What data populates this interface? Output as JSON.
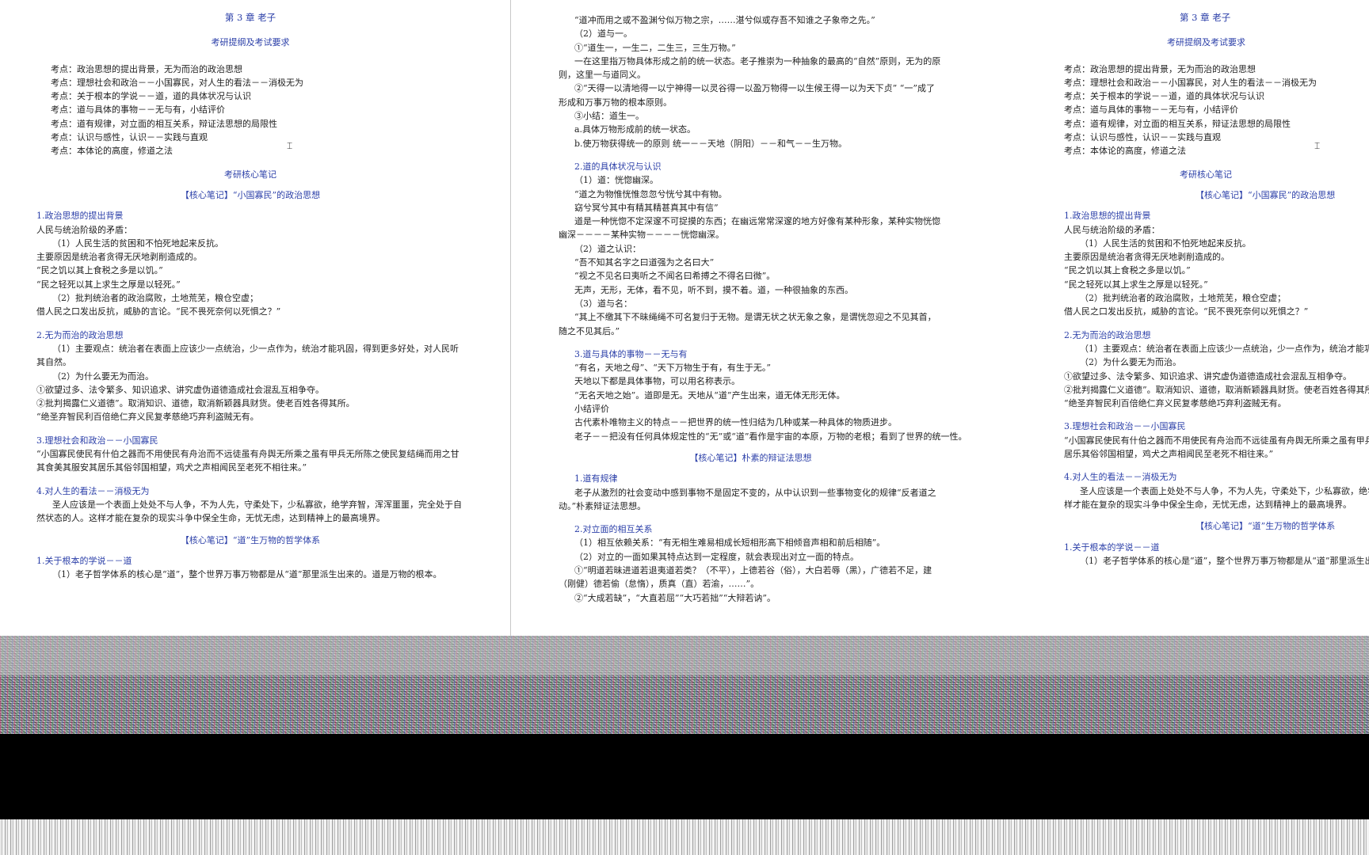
{
  "chapter_title": "第 3 章   老子",
  "outline_heading": "考研提纲及考试要求",
  "exam_points": [
    "考点：政治思想的提出背景，无为而治的政治思想",
    "考点：理想社会和政治－－小国寡民，对人生的看法－－消极无为",
    "考点：关于根本的学说－－道，道的具体状况与认识",
    "考点：道与具体的事物－－无与有，小结评价",
    "考点：道有规律，对立面的相互关系，辩证法思想的局限性",
    "考点：认识与感性，认识－－实践与直观",
    "考点：本体论的高度，修道之法"
  ],
  "notes_heading": "考研核心笔记",
  "left_page": {
    "core1": "【核心笔记】“小国寡民”的政治思想",
    "s1_heading": "1.政治思想的提出背景",
    "s1_lines": [
      "人民与统治阶级的矛盾：",
      "（1）人民生活的贫困和不怕死地起来反抗。",
      "主要原因是统治者贪得无厌地剥削造成的。",
      "“民之饥以其上食税之多是以饥。”",
      "“民之轻死以其上求生之厚是以轻死。”",
      "（2）批判统治者的政治腐败，土地荒芜，粮仓空虚；",
      "借人民之口发出反抗，威胁的言论。“民不畏死奈何以死惧之？”"
    ],
    "s2_heading": "2.无为而治的政治思想",
    "s2_lines": [
      "（1）主要观点：统治者在表面上应该少一点统治，少一点作为，统治才能巩固，得到更多好处，对人民听其自然。",
      "（2）为什么要无为而治。",
      "①欲望过多、法令繁多、知识追求、讲究虚伪道德造成社会混乱互相争夺。",
      "②批判揭露仁义道德”。取消知识、道德，取消新颖器具财货。使老百姓各得其所。",
      "“绝圣弃智民利百倍绝仁弃义民复孝慈绝巧弃利盗贼无有。"
    ],
    "s3_heading": "3.理想社会和政治－－小国寡民",
    "s3_lines": [
      "“小国寡民使民有什伯之器而不用使民有舟治而不远徒虽有舟舆无所乘之虽有甲兵无所陈之使民复结绳而用之甘其食美其服安其居乐其俗邻国相望，鸡犬之声相闻民至老死不相往来。”"
    ],
    "s4_heading": "4.对人生的看法－－消极无为",
    "s4_lines": [
      "圣人应该是一个表面上处处不与人争，不为人先，守柔处下，少私寡欲，绝学弃智，浑浑噩噩，完全处于自然状态的人。这样才能在复杂的现实斗争中保全生命，无忧无虑，达到精神上的最高境界。"
    ],
    "core2": "【核心笔记】“道”生万物的哲学体系",
    "s5_heading": "1.关于根本的学说－－道",
    "s5_lines": [
      "（1）老子哲学体系的核心是“道”，整个世界万事万物都是从“道”那里派生出来的。道是万物的根本。"
    ]
  },
  "mid_page": {
    "top_lines": [
      "“道冲而用之或不盈渊兮似万物之宗，……湛兮似或存吾不知谁之子象帝之先。”",
      "（2）道与一。",
      "①“道生一，一生二，二生三，三生万物。”",
      "一在这里指万物具体形成之前的统一状态。老子推崇为一种抽象的最高的“自然”原则，无为的原则，这里一与道同义。",
      "②“天得一以清地得一以宁神得一以灵谷得一以盈万物得一以生候王得一以为天下贞”   “一”成了形成和万事万物的根本原则。",
      "③小结：道生一。",
      "a.具体万物形成前的统一状态。",
      "b.使万物获得统一的原则    统一－－天地（阴阳）－－和气－－生万物。"
    ],
    "s2_heading": "2.道的具体状况与认识",
    "s2_lines": [
      "（1）道：恍惚幽深。",
      "“道之为物惟恍惟忽忽兮恍兮其中有物。",
      "窈兮冥兮其中有精其精甚真其中有信”",
      "道是一种恍惚不定深邃不可捉摸的东西；在幽远常常深邃的地方好像有某种形象，某种实物恍惚幽深－－－－某种实物－－－－恍惚幽深。",
      "（2）道之认识：",
      "“吾不知其名字之曰道强为之名曰大”",
      "“视之不见名曰夷听之不闻名曰希搏之不得名曰微”。",
      "无声，无形，无体，看不见，听不到，摸不着。道，一种很抽象的东西。",
      "（3）道与名：",
      "“其上不缴其下不昧绳绳不可名复归于无物。是谓无状之状无象之象，是谓恍忽迎之不见其首，随之不见其后。”"
    ],
    "s3_heading": "3.道与具体的事物－－无与有",
    "s3_lines": [
      "“有名，天地之母”、“天下万物生于有，有生于无。”",
      "天地以下都是具体事物，可以用名称表示。",
      "“无名天地之始”。道即是无。天地从“道”产生出来，道无体无形无体。",
      "小结评价",
      "古代素朴唯物主义的特点－－把世界的统一性归结为几种或某一种具体的物质进步。",
      "老子－－把没有任何具体规定性的“无”或“道”看作是宇宙的本原，万物的老根；看到了世界的统一性。"
    ],
    "core": "【核心笔记】朴素的辩证法思想",
    "r1_heading": "1.道有规律",
    "r1_lines": [
      "老子从激烈的社会变动中感到事物不是固定不变的，从中认识到一些事物变化的规律“反者道之动。”朴素辩证法思想。"
    ],
    "r2_heading": "2.对立面的相互关系",
    "r2_lines": [
      "（1）相互依赖关系：“有无相生难易相成长短相形高下相倾音声相和前后相随”。",
      "（2）对立的一面如果其特点达到一定程度，就会表现出对立一面的特点。",
      "①“明道若昧进道若退夷道若类？（不平），上德若谷（俗），大白若辱（黑），广德若不足，建（刚健）德若偷（怠惰），质真（直）若渝，……”。",
      "②“大成若缺”，“大直若屈”“大巧若拙”“大辩若讷”。"
    ]
  }
}
